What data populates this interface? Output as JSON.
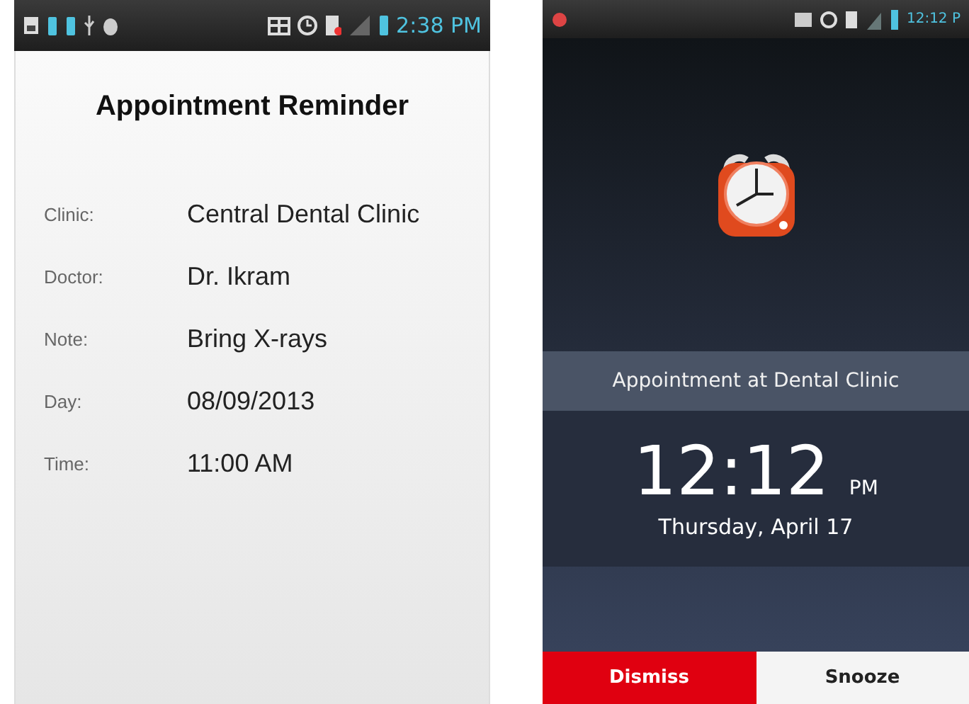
{
  "reminder_screen": {
    "status_bar": {
      "time": "2:38 PM"
    },
    "title": "Appointment Reminder",
    "fields": [
      {
        "label": "Clinic:",
        "value": "Central Dental Clinic"
      },
      {
        "label": "Doctor:",
        "value": "Dr. Ikram"
      },
      {
        "label": "Note:",
        "value": "Bring X-rays"
      },
      {
        "label": "Day:",
        "value": "08/09/2013"
      },
      {
        "label": "Time:",
        "value": "11:00 AM"
      }
    ]
  },
  "alarm_screen": {
    "status_bar": {
      "time": "12:12 P"
    },
    "banner": "Appointment at Dental Clinic",
    "time": "12:12",
    "ampm": "PM",
    "date": "Thursday, April 17",
    "buttons": [
      {
        "label": "Dismiss",
        "kind": "primary"
      },
      {
        "label": "Snooze",
        "kind": "secondary"
      }
    ]
  }
}
